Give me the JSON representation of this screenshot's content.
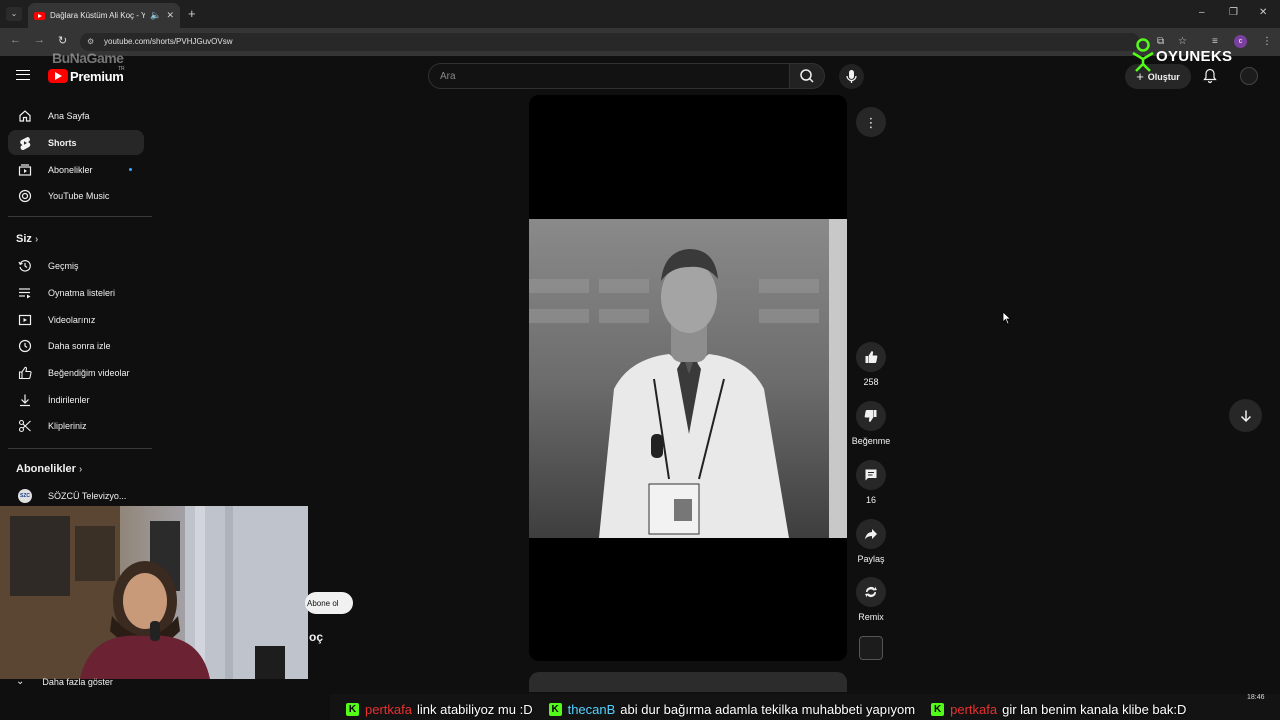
{
  "browser": {
    "tab_title": "Dağlara Küstüm Ali Koç - Yo",
    "url": "youtube.com/shorts/PVHJGuvOVsw",
    "new_tab": "+",
    "minimize": "–",
    "restore": "❐",
    "close": "✕"
  },
  "header": {
    "logo_text": "Premium",
    "logo_country": "TR",
    "watermark": "BuNaGame",
    "search_placeholder": "Ara",
    "create_label": "Oluştur",
    "stream_overlay_logo": "OYUNEKS"
  },
  "sidebar": {
    "top_items": [
      {
        "label": "Ana Sayfa",
        "icon": "home-icon"
      },
      {
        "label": "Shorts",
        "icon": "shorts-icon",
        "active": true
      },
      {
        "label": "Abonelikler",
        "icon": "subscriptions-icon"
      },
      {
        "label": "YouTube Music",
        "icon": "music-icon"
      }
    ],
    "you_heading": "Siz",
    "you_items": [
      {
        "label": "Geçmiş",
        "icon": "history-icon"
      },
      {
        "label": "Oynatma listeleri",
        "icon": "playlists-icon"
      },
      {
        "label": "Videolarınız",
        "icon": "your-videos-icon"
      },
      {
        "label": "Daha sonra izle",
        "icon": "watch-later-icon"
      },
      {
        "label": "Beğendiğim videolar",
        "icon": "liked-icon"
      },
      {
        "label": "İndirilenler",
        "icon": "downloads-icon"
      },
      {
        "label": "Klipleriniz",
        "icon": "clips-icon"
      }
    ],
    "subs_heading": "Abonelikler",
    "subs_items": [
      {
        "label": "SÖZCÜ Televizyo...",
        "icon": "channel-avatar"
      }
    ],
    "show_more": "Daha fazla göster"
  },
  "short": {
    "likes": "258",
    "dislike_label": "Beğenme",
    "comments": "16",
    "share_label": "Paylaş",
    "remix_label": "Remix",
    "subscribe_label": "Abone ol",
    "channel_name_fragment": "oç"
  },
  "chat": {
    "messages": [
      {
        "user": "pertkafa",
        "text": "link atabiliyoz mu :D"
      },
      {
        "user": "thecanB",
        "text": "abi dur bağırma adamla tekilka muhabbeti yapıyom"
      },
      {
        "user": "pertkafa",
        "text": "gir lan benim kanala klibe bak:D"
      }
    ],
    "badge": "K"
  },
  "clock": "18:46",
  "colors": {
    "accent_red": "#ff0000",
    "kick_green": "#53fc18",
    "bg": "#0f0f0f"
  }
}
